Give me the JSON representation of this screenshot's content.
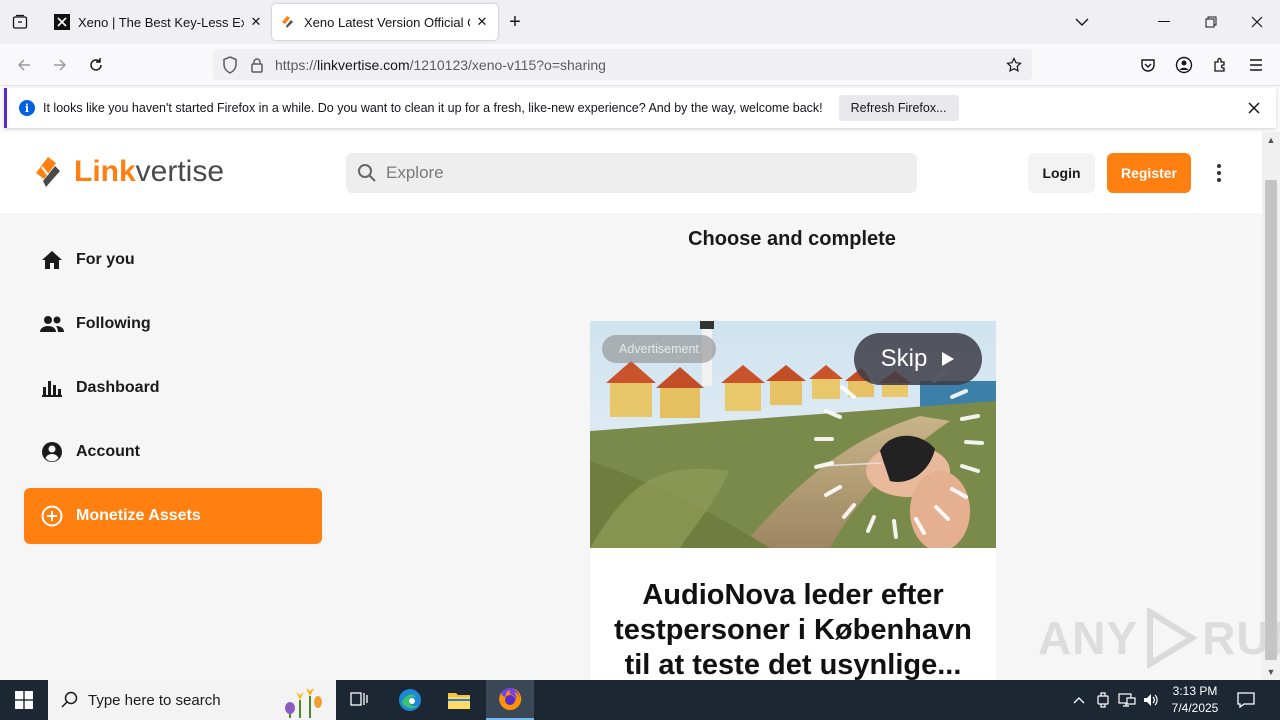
{
  "browser": {
    "tabs": [
      {
        "title": "Xeno | The Best Key-Less Execut",
        "active": false
      },
      {
        "title": "Xeno Latest Version Official Cor",
        "active": true
      }
    ],
    "url_prefix": "https://",
    "url_domain": "linkvertise.com",
    "url_path": "/1210123/xeno-v115?o=sharing"
  },
  "notification": {
    "message": "It looks like you haven't started Firefox in a while. Do you want to clean it up for a fresh, like-new experience? And by the way, welcome back!",
    "button_label": "Refresh Firefox..."
  },
  "site": {
    "logo_part1": "Link",
    "logo_part2": "vertise",
    "search_placeholder": "Explore",
    "login_label": "Login",
    "register_label": "Register",
    "brand_color": "#ff7f11",
    "nav": [
      {
        "label": "For you",
        "icon": "home-icon"
      },
      {
        "label": "Following",
        "icon": "people-icon"
      },
      {
        "label": "Dashboard",
        "icon": "bar-chart-icon"
      },
      {
        "label": "Account",
        "icon": "account-circle-icon"
      },
      {
        "label": "Monetize Assets",
        "icon": "plus-circle-icon"
      }
    ],
    "heading": "Choose and complete",
    "ad": {
      "label": "Advertisement",
      "skip_label": "Skip",
      "title": "AudioNova leder efter testpersoner i København til at teste det usynlige..."
    }
  },
  "watermark": {
    "left": "ANY",
    "right": "RUN"
  },
  "taskbar": {
    "search_placeholder": "Type here to search",
    "time": "3:13 PM",
    "date": "7/4/2025"
  }
}
